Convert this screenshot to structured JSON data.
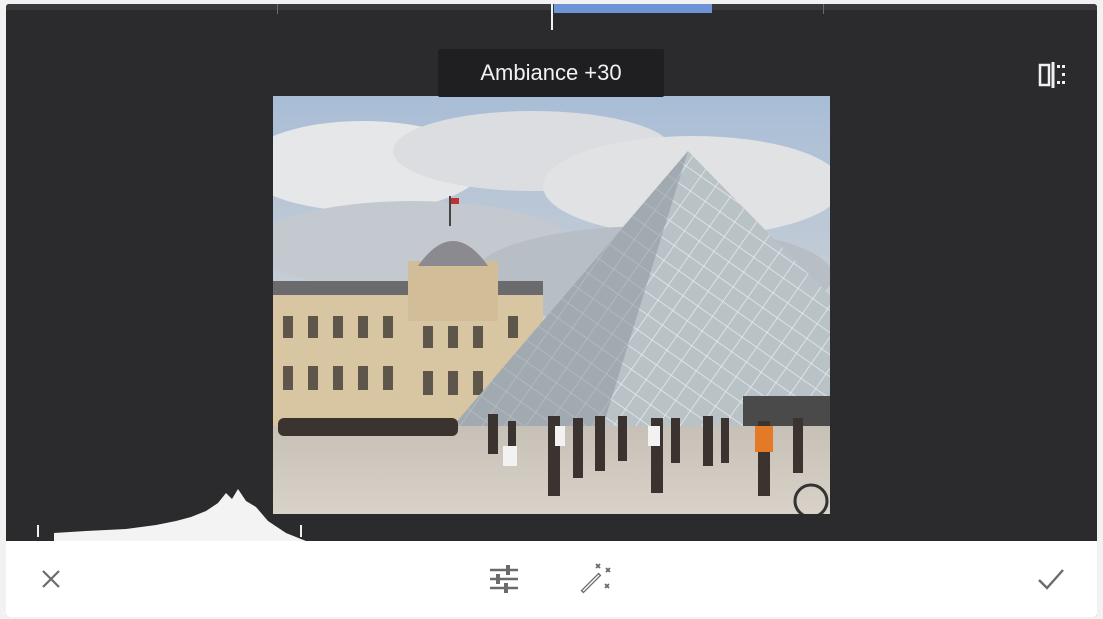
{
  "adjustment": {
    "label": "Ambiance +30",
    "value": 30
  },
  "slider": {
    "fraction": 0.65
  },
  "icons": {
    "compare": "compare-split-icon",
    "cancel": "close-icon",
    "tune": "sliders-icon",
    "magic": "magic-wand-icon",
    "apply": "checkmark-icon"
  },
  "colors": {
    "background": "#2b2b2d",
    "accent": "#6f94d6",
    "toolbar": "#ffffff",
    "icon": "#6b6b6b"
  }
}
